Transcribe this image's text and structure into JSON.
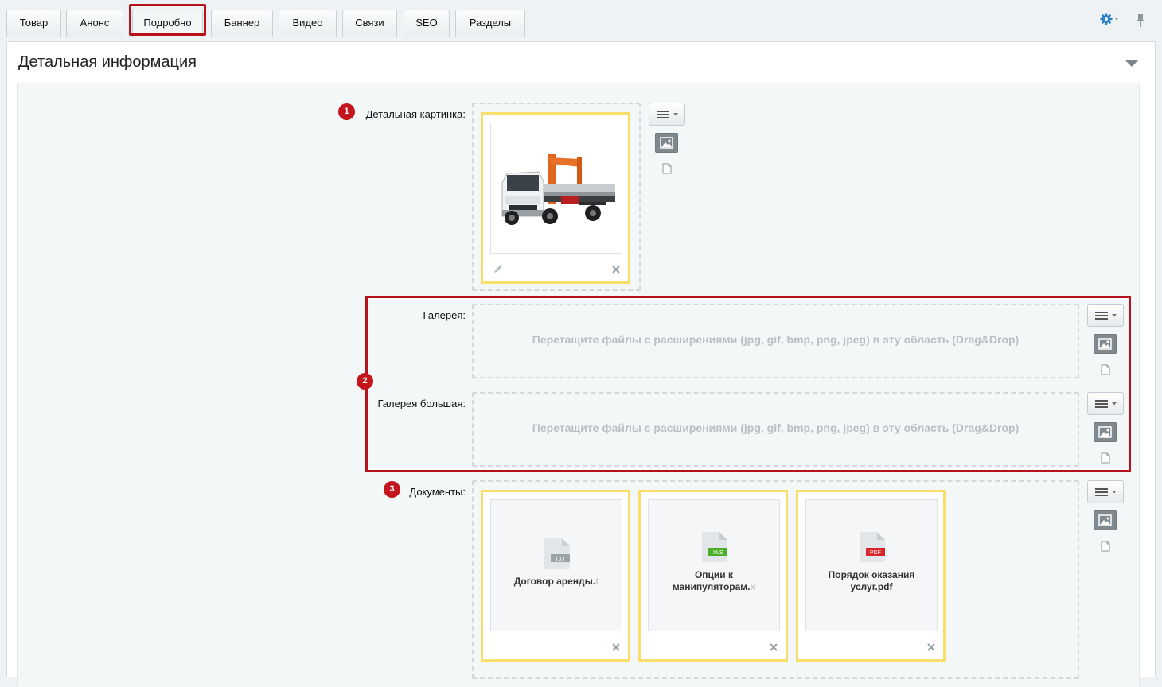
{
  "tabs": [
    {
      "label": "Товар"
    },
    {
      "label": "Анонс"
    },
    {
      "label": "Подробно"
    },
    {
      "label": "Баннер"
    },
    {
      "label": "Видео"
    },
    {
      "label": "Связи"
    },
    {
      "label": "SEO"
    },
    {
      "label": "Разделы"
    }
  ],
  "active_tab": "Подробно",
  "section": {
    "title": "Детальная информация"
  },
  "fields": {
    "detail_picture": {
      "label": "Детальная картинка:",
      "badge": "1"
    },
    "gallery": {
      "label": "Галерея:",
      "hint": "Перетащите файлы с расширениями (jpg, gif, bmp, png, jpeg) в эту область (Drag&Drop)"
    },
    "gallery_big": {
      "label": "Галерея большая:",
      "hint": "Перетащите файлы с расширениями (jpg, gif, bmp, png, jpeg) в эту область (Drag&Drop)"
    },
    "gallery_badge": "2",
    "documents": {
      "label": "Документы:",
      "badge": "3",
      "files": [
        {
          "name_main": "Договор аренды.",
          "name_fade": "t",
          "ext": "TXT"
        },
        {
          "name_main": "Опции к манипуляторам.",
          "name_fade": "x",
          "ext": "XLS"
        },
        {
          "name_main": "Порядок оказания услуг.pdf",
          "name_fade": "",
          "ext": "PDF"
        }
      ]
    }
  },
  "colors": {
    "highlight": "#b5121b",
    "card_border": "#f8df6b",
    "xls": "#4caf2a",
    "pdf": "#d9252c",
    "txt": "#9da4a8"
  }
}
